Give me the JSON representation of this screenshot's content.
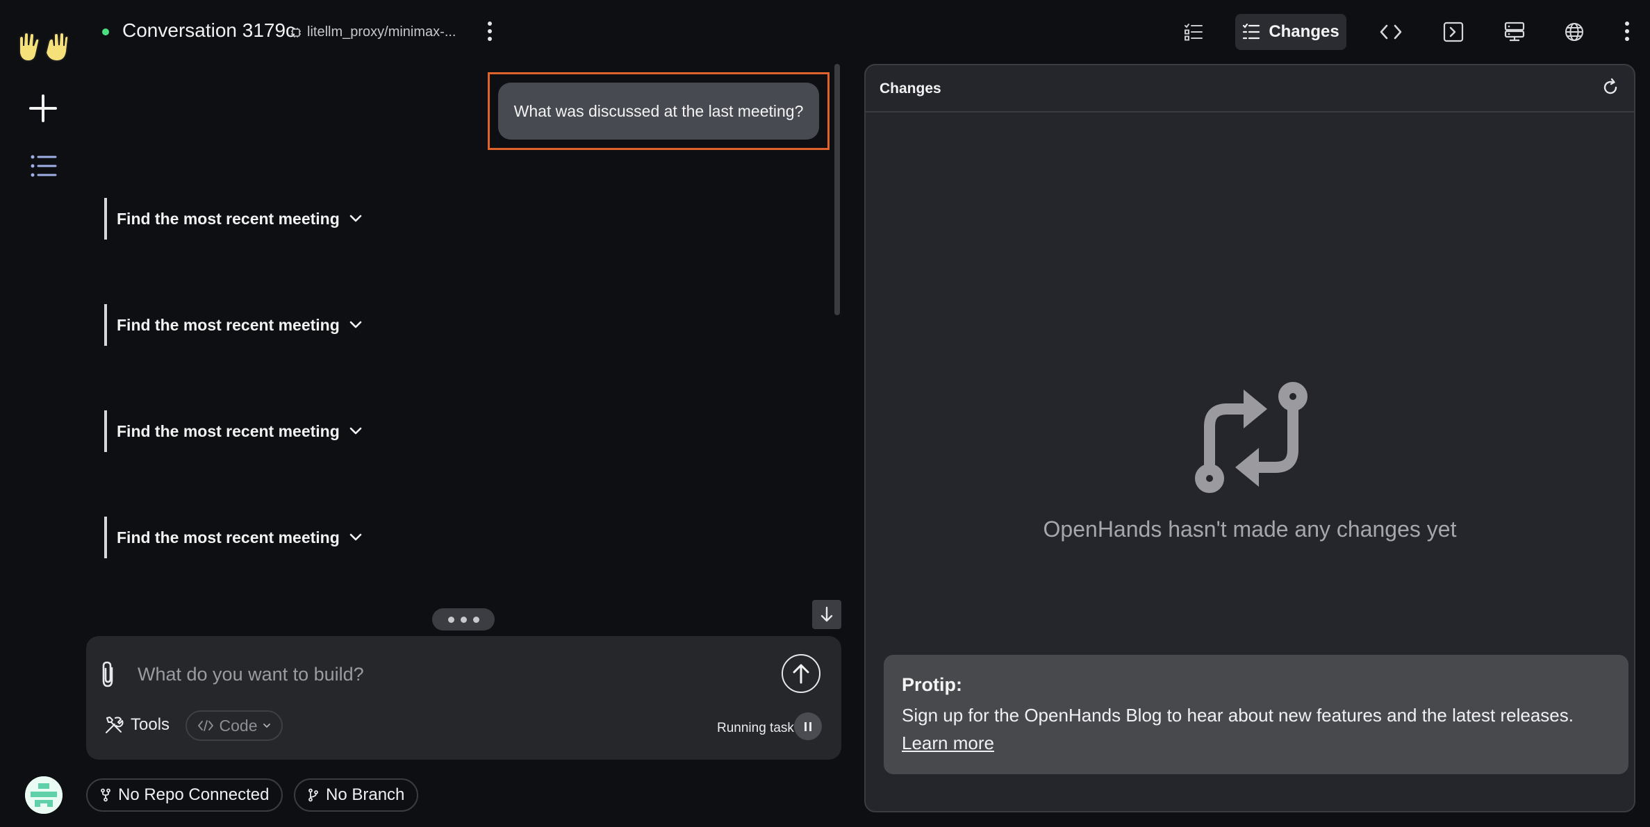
{
  "header": {
    "conversation_title": "Conversation 3179c",
    "model_name": "litellm_proxy/minimax-...",
    "changes_tab_label": "Changes",
    "status_color": "#4ade80"
  },
  "chat": {
    "user_message": "What was discussed at the last meeting?",
    "steps": [
      {
        "label": "Find the most recent meeting"
      },
      {
        "label": "Find the most recent meeting"
      },
      {
        "label": "Find the most recent meeting"
      },
      {
        "label": "Find the most recent meeting"
      }
    ]
  },
  "composer": {
    "placeholder": "What do you want to build?",
    "value": "",
    "tools_label": "Tools",
    "code_label": "Code",
    "running_label": "Running task"
  },
  "bottom": {
    "repo_label": "No Repo Connected",
    "branch_label": "No Branch"
  },
  "panel": {
    "title": "Changes",
    "empty_message": "OpenHands hasn't made any changes yet",
    "protip_title": "Protip:",
    "protip_body": "Sign up for the OpenHands Blog to hear about new features and the latest releases.",
    "protip_link": "Learn more"
  },
  "colors": {
    "highlight_border": "#e0632c",
    "logo_hands": "#f5e07a"
  },
  "icons": {
    "rail": [
      "openhands-logo-icon",
      "plus-icon",
      "list-icon"
    ],
    "topbar": [
      "checklist-icon",
      "changes-list-icon",
      "code-icon",
      "terminal-icon",
      "server-icon",
      "globe-icon",
      "kebab-icon"
    ]
  }
}
